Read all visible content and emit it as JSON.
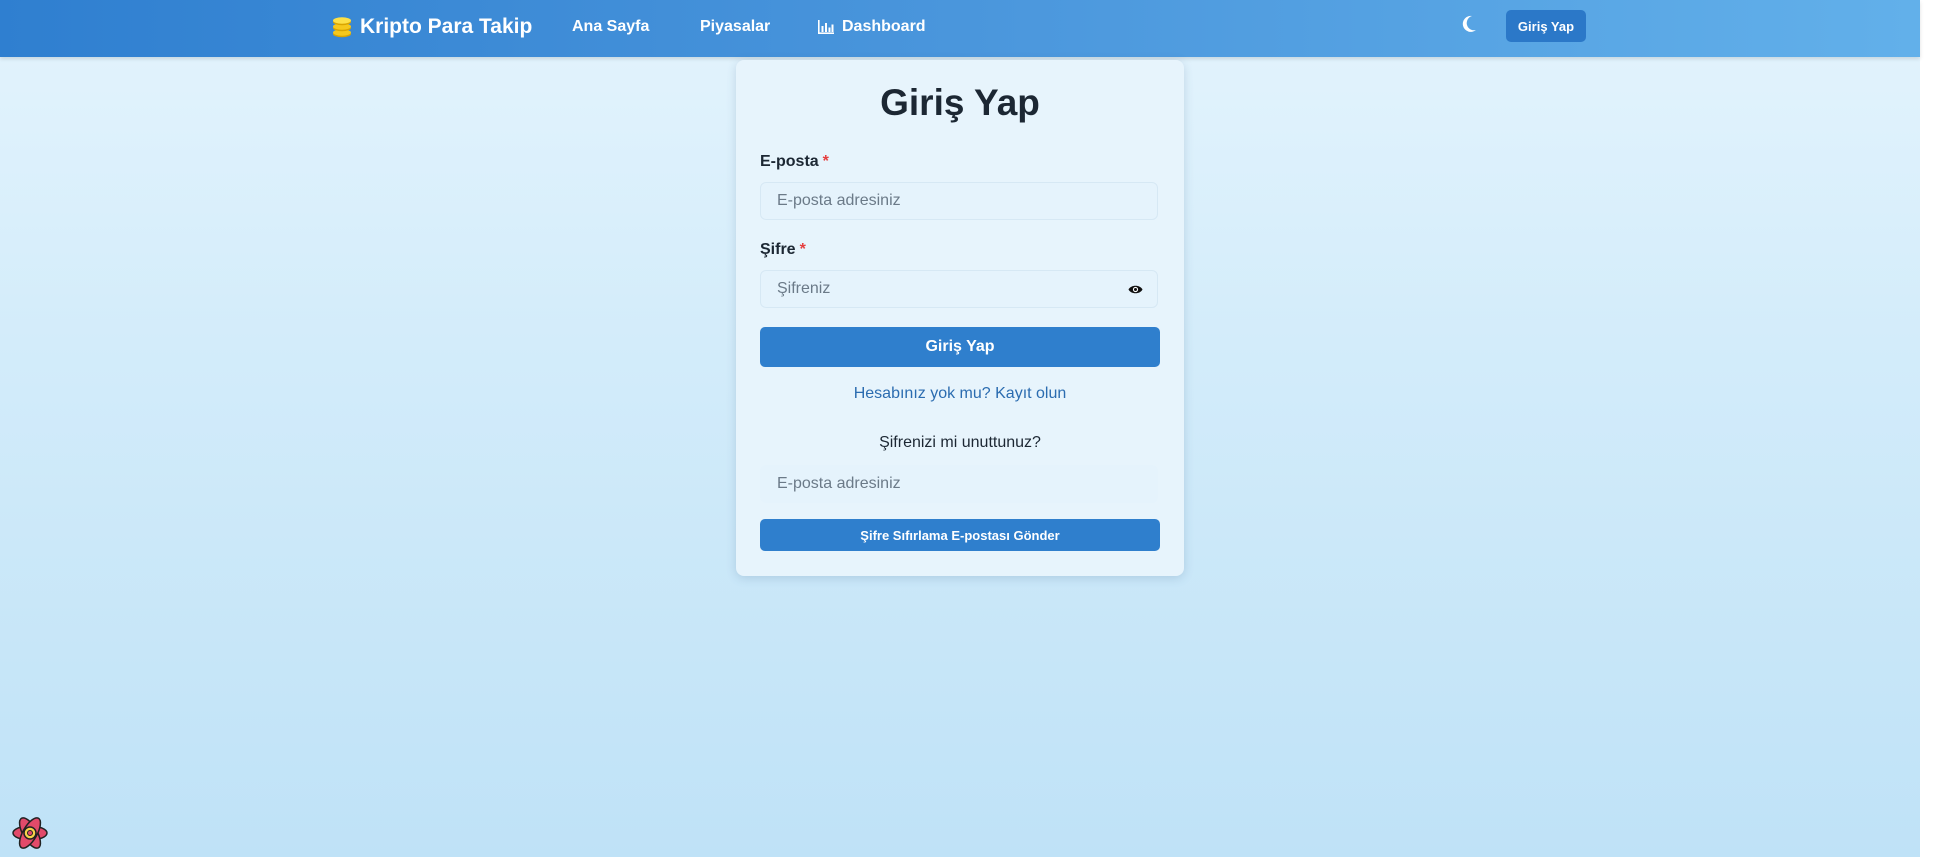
{
  "navbar": {
    "brand": "Kripto Para Takip",
    "brand_icon": "coins-icon",
    "links": {
      "home": "Ana Sayfa",
      "markets": "Piyasalar",
      "dashboard": "Dashboard"
    },
    "dashboard_icon": "bar-chart-icon",
    "theme_icon": "moon-icon",
    "login_button": "Giriş Yap"
  },
  "login_form": {
    "title": "Giriş Yap",
    "email_label": "E-posta",
    "email_placeholder": "E-posta adresiniz",
    "email_value": "",
    "password_label": "Şifre",
    "password_placeholder": "Şifreniz",
    "password_value": "",
    "required_mark": "*",
    "password_toggle_icon": "eye-icon",
    "submit_label": "Giriş Yap",
    "register_link": "Hesabınız yok mu? Kayıt olun"
  },
  "forgot_password": {
    "prompt": "Şifrenizi mi unuttunuz?",
    "email_placeholder": "E-posta adresiniz",
    "email_value": "",
    "submit_label": "Şifre Sıfırlama E-postası Gönder"
  },
  "colors": {
    "navbar_start": "#2f7fd0",
    "navbar_end": "#62b0ea",
    "primary": "#2f7fcd",
    "link": "#2b6cb0",
    "required": "#e53e3e"
  },
  "devtools_icon": "react-devtools-icon"
}
